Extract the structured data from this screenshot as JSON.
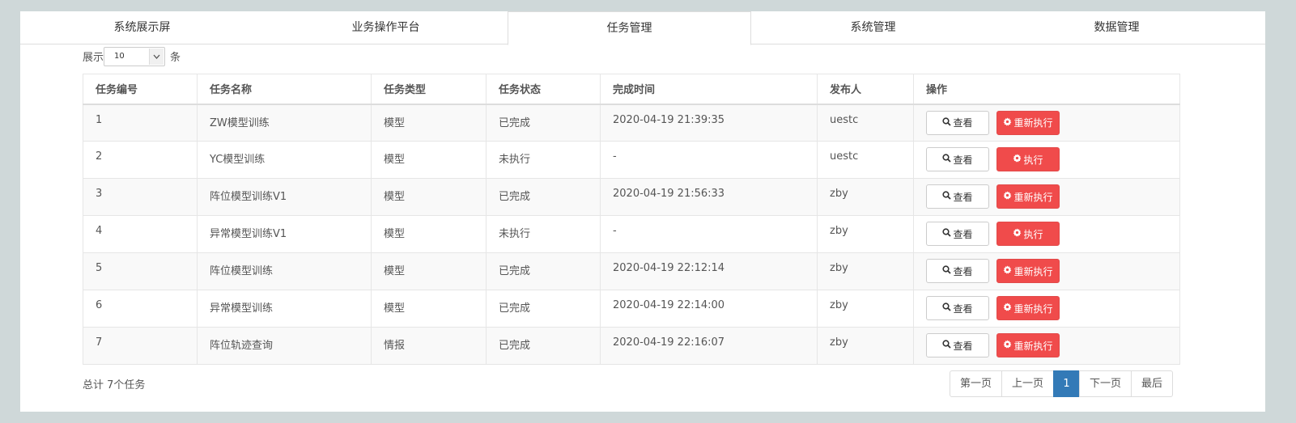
{
  "tabs": [
    {
      "label": "系统展示屏"
    },
    {
      "label": "业务操作平台"
    },
    {
      "label": "任务管理"
    },
    {
      "label": "系统管理"
    },
    {
      "label": "数据管理"
    }
  ],
  "page_size": {
    "prefix": "展示",
    "value": "10",
    "suffix": "条"
  },
  "table": {
    "headers": [
      "任务编号",
      "任务名称",
      "任务类型",
      "任务状态",
      "完成时间",
      "发布人",
      "操作"
    ],
    "rows": [
      {
        "id": "1",
        "name": "ZW模型训练",
        "type": "模型",
        "status": "已完成",
        "time": "2020-04-19 21:39:35",
        "publisher": "uestc",
        "view": "查看",
        "action": "重新执行"
      },
      {
        "id": "2",
        "name": "YC模型训练",
        "type": "模型",
        "status": "未执行",
        "time": "-",
        "publisher": "uestc",
        "view": "查看",
        "action": "执行"
      },
      {
        "id": "3",
        "name": "阵位模型训练V1",
        "type": "模型",
        "status": "已完成",
        "time": "2020-04-19 21:56:33",
        "publisher": "zby",
        "view": "查看",
        "action": "重新执行"
      },
      {
        "id": "4",
        "name": "异常模型训练V1",
        "type": "模型",
        "status": "未执行",
        "time": "-",
        "publisher": "zby",
        "view": "查看",
        "action": "执行"
      },
      {
        "id": "5",
        "name": "阵位模型训练",
        "type": "模型",
        "status": "已完成",
        "time": "2020-04-19 22:12:14",
        "publisher": "zby",
        "view": "查看",
        "action": "重新执行"
      },
      {
        "id": "6",
        "name": "异常模型训练",
        "type": "模型",
        "status": "已完成",
        "time": "2020-04-19 22:14:00",
        "publisher": "zby",
        "view": "查看",
        "action": "重新执行"
      },
      {
        "id": "7",
        "name": "阵位轨迹查询",
        "type": "情报",
        "status": "已完成",
        "time": "2020-04-19 22:16:07",
        "publisher": "zby",
        "view": "查看",
        "action": "重新执行"
      }
    ]
  },
  "footer": {
    "total": "总计 7个任务"
  },
  "pagination": {
    "first": "第一页",
    "prev": "上一页",
    "current": "1",
    "next": "下一页",
    "last": "最后"
  },
  "colors": {
    "primary": "#337ab7",
    "danger": "#f04b4b",
    "background": "#cfd8d9"
  },
  "icons": {
    "view": "search-icon",
    "action": "gear-icon",
    "select": "chevron-down-icon"
  }
}
